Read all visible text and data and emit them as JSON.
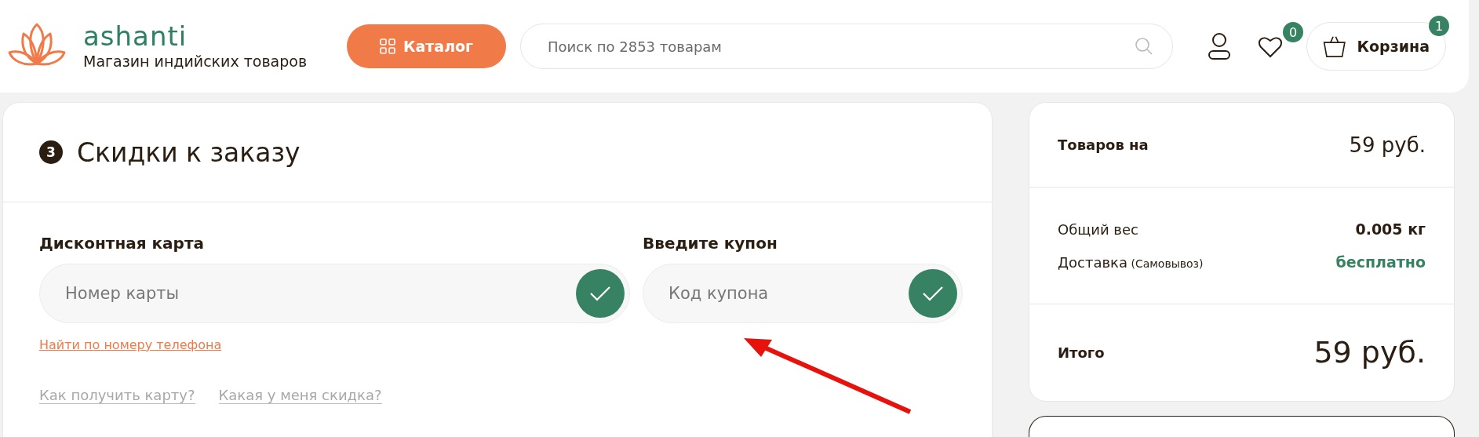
{
  "header": {
    "logo": {
      "name": "ashanti",
      "tagline": "Магазин индийских товаров"
    },
    "catalog_button": "Каталог",
    "search": {
      "placeholder": "Поиск по 2853 товарам"
    },
    "favorites_count": "0",
    "cart": {
      "label": "Корзина",
      "count": "1"
    }
  },
  "discounts": {
    "step": "3",
    "title": "Скидки к заказу",
    "fields": [
      {
        "label": "Дисконтная карта",
        "placeholder": "Номер карты"
      },
      {
        "label": "Введите купон",
        "placeholder": "Код купона"
      }
    ],
    "phone_link": "Найти по номеру телефона",
    "help_links": [
      "Как получить карту?",
      "Какая у меня скидка?"
    ]
  },
  "summary": {
    "subtotal": {
      "label": "Товаров на",
      "value": "59 руб."
    },
    "details": [
      {
        "label": "Общий вес",
        "value": "0.005 кг",
        "kind": "plain"
      },
      {
        "label": "Доставка",
        "note": "(Самовывоз)",
        "value": "бесплатно",
        "kind": "accent"
      }
    ],
    "total": {
      "label": "Итого",
      "value": "59 руб."
    }
  }
}
